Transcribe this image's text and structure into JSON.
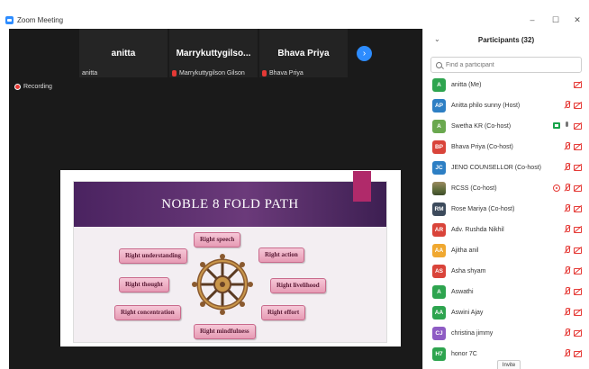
{
  "window": {
    "title": "Zoom Meeting",
    "minimize": "–",
    "maximize": "☐",
    "close": "✕"
  },
  "video_strip": {
    "tiles": [
      {
        "name": "anitta",
        "caption": "anitta",
        "muted": false
      },
      {
        "name": "Marrykuttygilso...",
        "caption": "Marrykuttygilson Gilson",
        "muted": true
      },
      {
        "name": "Bhava Priya",
        "caption": "Bhava Priya",
        "muted": true
      }
    ],
    "next_label": "›"
  },
  "recording_label": "Recording",
  "slide": {
    "title": "NOBLE 8 FOLD PATH",
    "items": [
      "Right speech",
      "Right understanding",
      "Right action",
      "Right thought",
      "Right livelihood",
      "Right concentration",
      "Right effort",
      "Right mindfulness"
    ]
  },
  "participants": {
    "collapse_icon": "chevron-down-icon",
    "title": "Participants (32)",
    "search_placeholder": "Find a participant",
    "invite_label": "Invite",
    "list": [
      {
        "initials": "A",
        "color": "#2ea44f",
        "name": "anitta (Me)",
        "icons": [
          "cam-off"
        ]
      },
      {
        "initials": "AP",
        "color": "#2d7fc4",
        "name": "Anitta philo sunny (Host)",
        "icons": [
          "mic-off",
          "cam-off"
        ]
      },
      {
        "initials": "A",
        "color": "#6aa84f",
        "name": "Swetha KR (Co-host)",
        "icons": [
          "share",
          "mic-on",
          "cam-off"
        ]
      },
      {
        "initials": "BP",
        "color": "#d9443a",
        "name": "Bhava Priya (Co-host)",
        "icons": [
          "mic-off",
          "cam-off"
        ]
      },
      {
        "initials": "JC",
        "color": "#2d7fc4",
        "name": "JENO COUNSELLOR (Co-host)",
        "icons": [
          "mic-off",
          "cam-off"
        ]
      },
      {
        "initials": "",
        "color": "#7a6a4a",
        "name": "RCSS (Co-host)",
        "icons": [
          "rec",
          "mic-off",
          "cam-off"
        ]
      },
      {
        "initials": "RM",
        "color": "#3d4b5c",
        "name": "Rose Mariya (Co-host)",
        "icons": [
          "mic-off",
          "cam-off"
        ]
      },
      {
        "initials": "AR",
        "color": "#d9443a",
        "name": "Adv. Rushda Nikhil",
        "icons": [
          "mic-off",
          "cam-off"
        ]
      },
      {
        "initials": "AA",
        "color": "#f0a830",
        "name": "Ajitha anil",
        "icons": [
          "mic-off",
          "cam-off"
        ]
      },
      {
        "initials": "AS",
        "color": "#d9443a",
        "name": "Asha shyam",
        "icons": [
          "mic-off",
          "cam-off"
        ]
      },
      {
        "initials": "A",
        "color": "#2ea44f",
        "name": "Aswathi",
        "icons": [
          "mic-off",
          "cam-off"
        ]
      },
      {
        "initials": "AA",
        "color": "#2ea44f",
        "name": "Aswini Ajay",
        "icons": [
          "mic-off",
          "cam-off"
        ]
      },
      {
        "initials": "CJ",
        "color": "#8e5cc4",
        "name": "christina jimmy",
        "icons": [
          "mic-off",
          "cam-off"
        ]
      },
      {
        "initials": "H7",
        "color": "#2ea44f",
        "name": "honor 7C",
        "icons": [
          "mic-off",
          "cam-off"
        ]
      }
    ]
  }
}
